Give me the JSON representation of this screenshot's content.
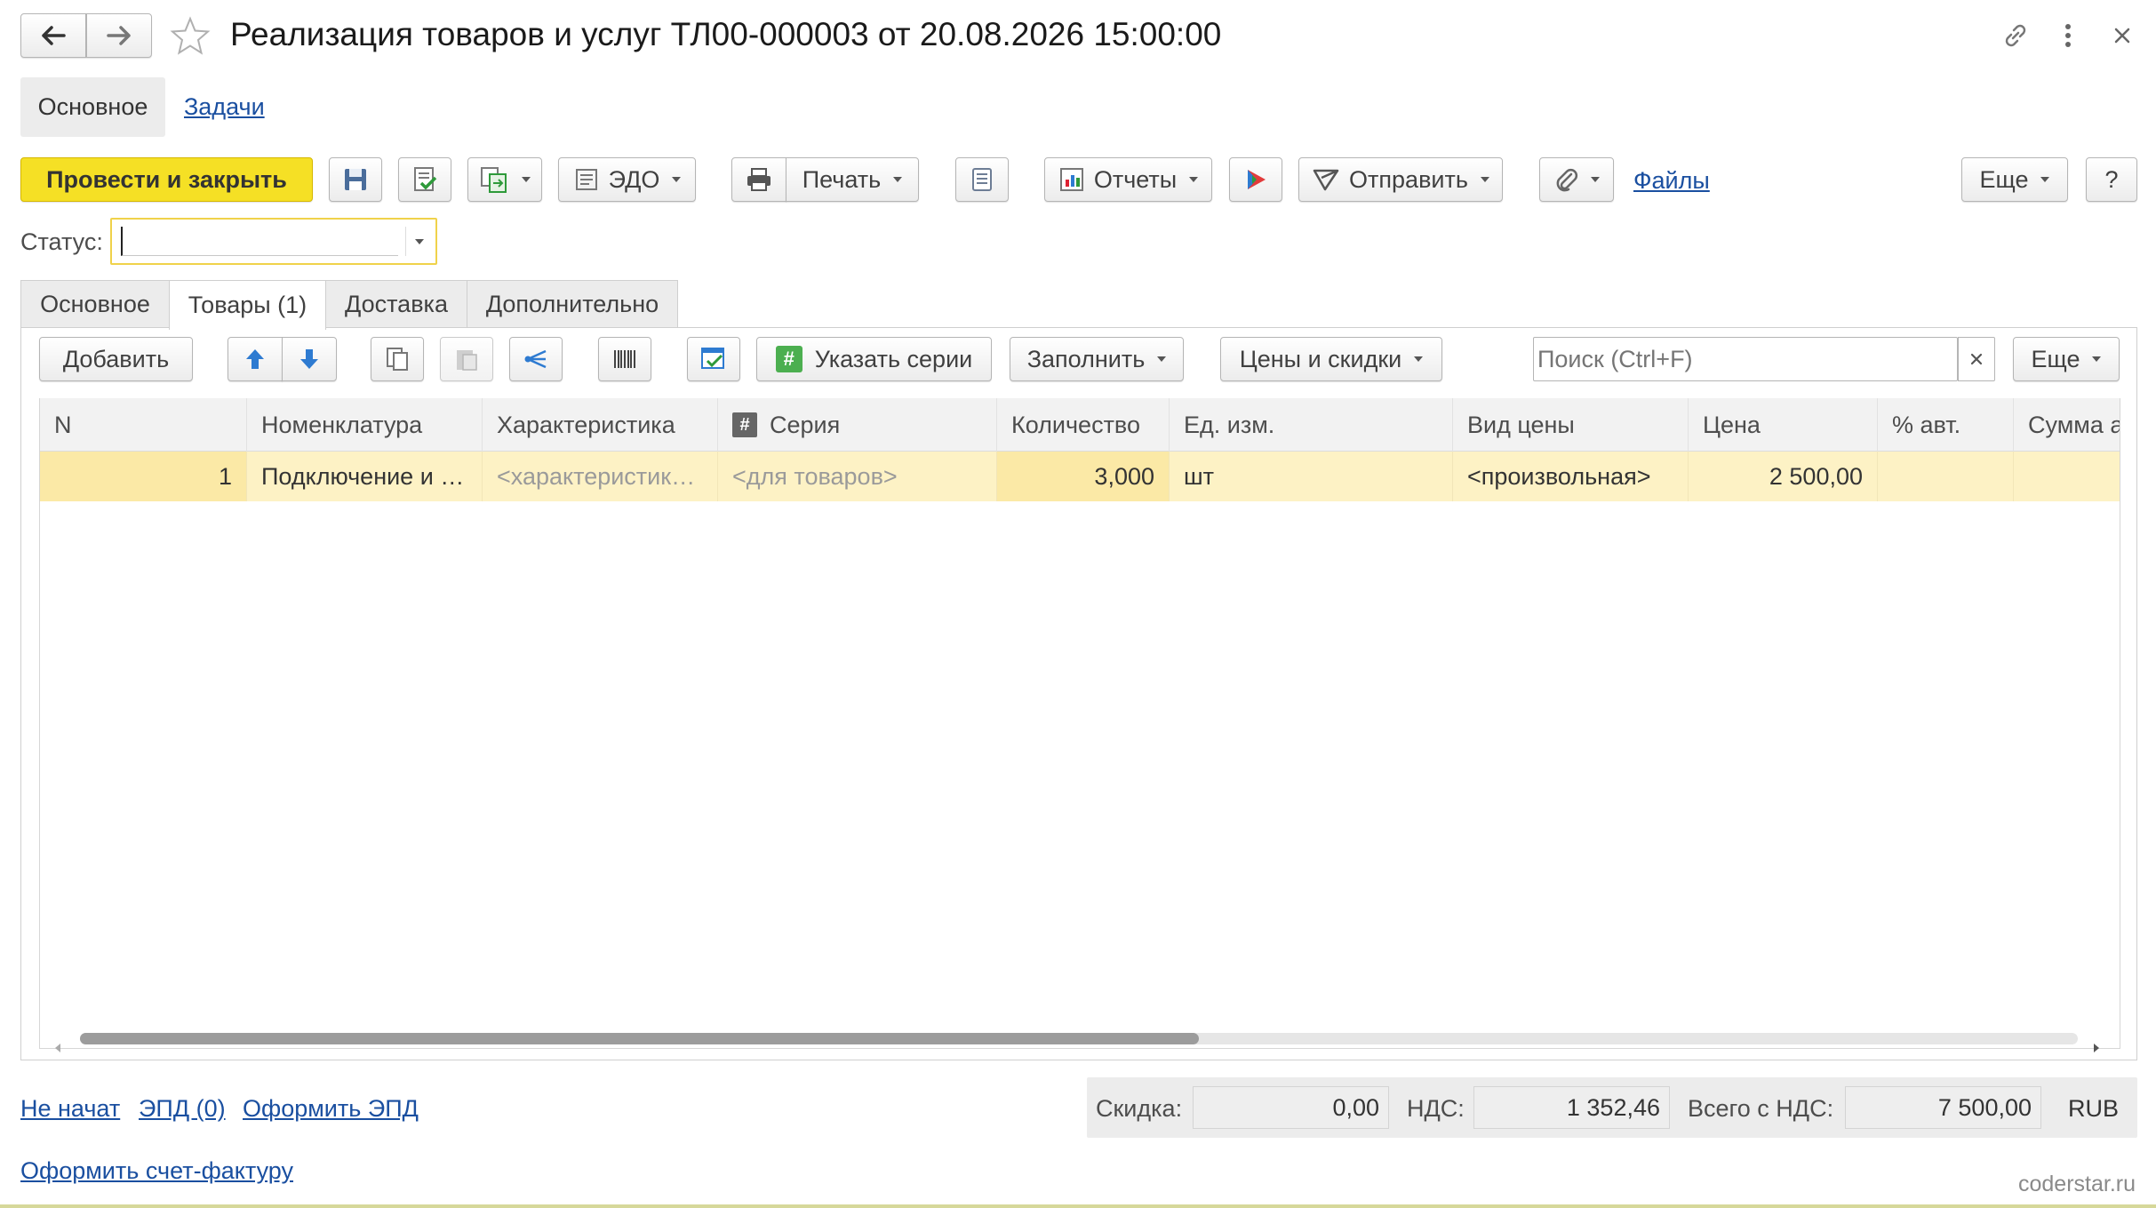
{
  "window": {
    "title": "Реализация товаров и услуг ТЛ00-000003 от 20.08.2026 15:00:00"
  },
  "nav_tabs": [
    {
      "label": "Основное"
    },
    {
      "label": "Задачи"
    }
  ],
  "toolbar": {
    "post_close_label": "Провести и закрыть",
    "edo_label": "ЭДО",
    "print_label": "Печать",
    "reports_label": "Отчеты",
    "send_label": "Отправить",
    "files_label": "Файлы",
    "more_label": "Еще",
    "help_label": "?"
  },
  "status": {
    "label": "Статус:",
    "value": ""
  },
  "form_tabs": [
    {
      "label": "Основное"
    },
    {
      "label": "Товары (1)"
    },
    {
      "label": "Доставка"
    },
    {
      "label": "Дополнительно"
    }
  ],
  "table_toolbar": {
    "add_label": "Добавить",
    "series_label": "Указать серии",
    "fill_label": "Заполнить",
    "prices_label": "Цены и скидки",
    "search_placeholder": "Поиск (Ctrl+F)",
    "more_label": "Еще"
  },
  "table": {
    "columns": [
      "N",
      "Номенклатура",
      "Характеристика",
      "Серия",
      "Количество",
      "Ед. изм.",
      "Вид цены",
      "Цена",
      "% авт.",
      "Сумма а"
    ],
    "rows": [
      {
        "n": "1",
        "item": "Подключение и …",
        "characteristic": "<характеристик…",
        "series": "<для товаров>",
        "quantity": "3,000",
        "unit": "шт",
        "price_type": "<произвольная>",
        "price": "2 500,00",
        "auto_pct": "",
        "sum": ""
      }
    ],
    "scroll_fraction": 0.56
  },
  "footer": {
    "status_link": "Не начат",
    "epd_link": "ЭПД (0)",
    "make_epd_link": "Оформить ЭПД",
    "invoice_link": "Оформить счет-фактуру",
    "discount_label": "Скидка:",
    "discount_value": "0,00",
    "vat_label": "НДС:",
    "vat_value": "1 352,46",
    "total_label": "Всего с НДС:",
    "total_value": "7 500,00",
    "currency": "RUB",
    "watermark": "coderstar.ru"
  },
  "colors": {
    "accent_yellow": "#f5e025",
    "selected_row": "#fdf2c5",
    "link": "#1a4fa0"
  },
  "icons": [
    "back-arrow-icon",
    "forward-arrow-icon",
    "star-icon",
    "link-icon",
    "kebab-icon",
    "close-icon",
    "save-icon",
    "post-icon",
    "create-based-icon",
    "edo-icon",
    "printer-icon",
    "document-list-icon",
    "reports-icon",
    "run-icon",
    "send-icon",
    "paperclip-icon",
    "arrow-up-icon",
    "arrow-down-icon",
    "copy-icon",
    "paste-icon",
    "share-icon",
    "barcode-icon",
    "check-document-icon",
    "hash-icon",
    "clear-search-icon"
  ]
}
